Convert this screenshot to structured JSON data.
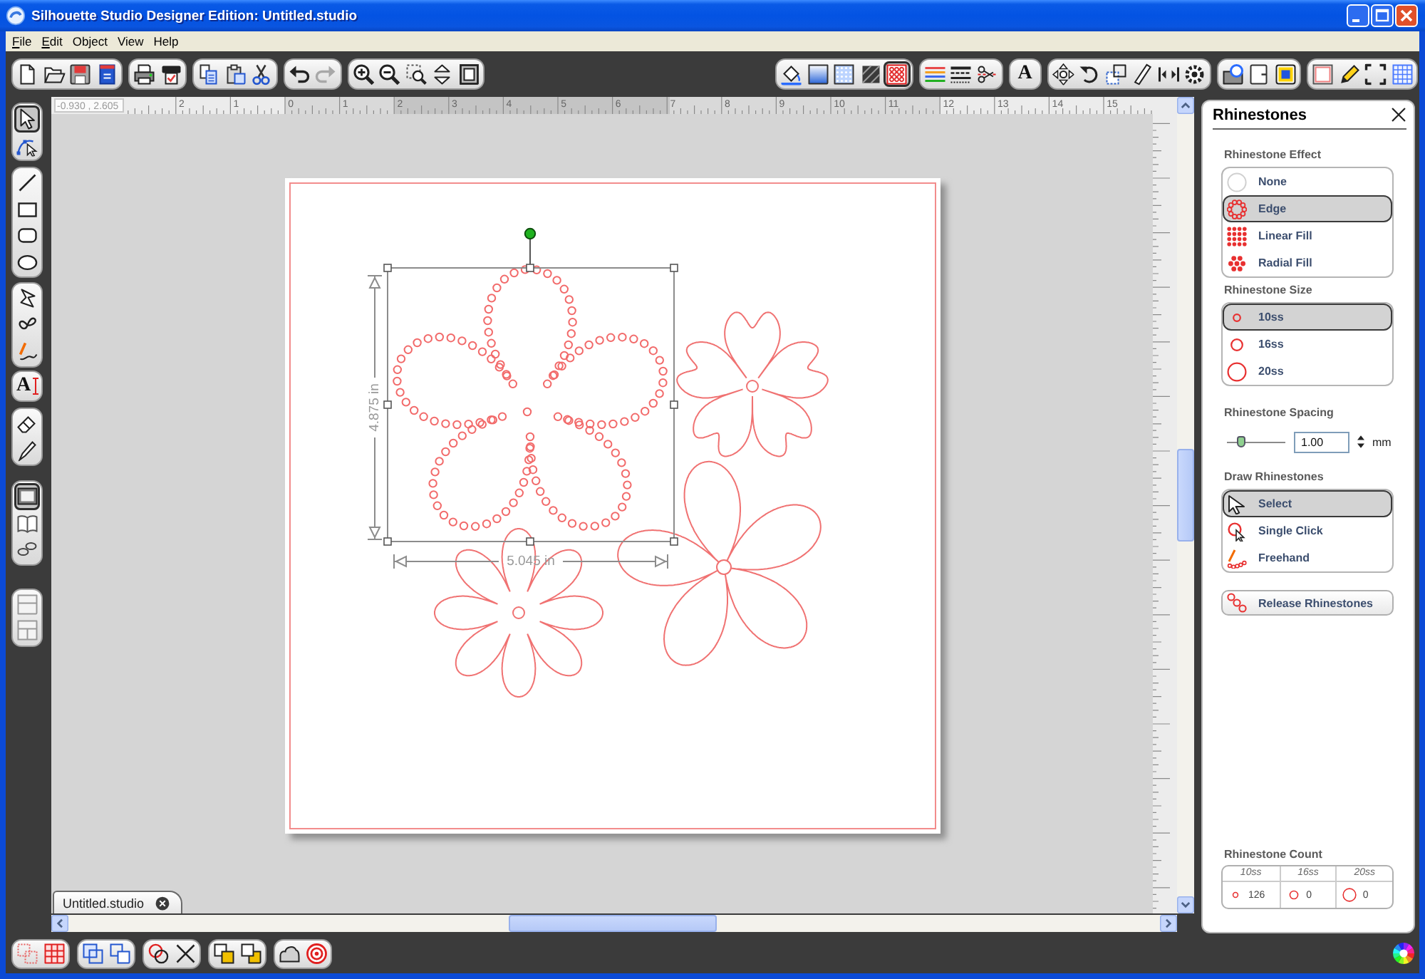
{
  "window": {
    "title": "Silhouette Studio Designer Edition: Untitled.studio"
  },
  "menu": [
    {
      "label": "File",
      "underline_first": true
    },
    {
      "label": "Edit",
      "underline_first": true
    },
    {
      "label": "Object",
      "underline_first": false
    },
    {
      "label": "View",
      "underline_first": false
    },
    {
      "label": "Help",
      "underline_first": false
    }
  ],
  "toolbar": {
    "left_groups": [
      {
        "items": [
          {
            "kind": "new"
          },
          {
            "kind": "open"
          },
          {
            "kind": "save"
          },
          {
            "kind": "save_library"
          }
        ]
      },
      {
        "items": [
          {
            "kind": "print"
          },
          {
            "kind": "send"
          }
        ]
      },
      {
        "items": [
          {
            "kind": "copy"
          },
          {
            "kind": "paste"
          },
          {
            "kind": "cut"
          }
        ]
      },
      {
        "items": [
          {
            "kind": "undo",
            "disabled": false
          },
          {
            "kind": "redo",
            "disabled": true
          }
        ]
      },
      {
        "items": [
          {
            "kind": "zoom_in"
          },
          {
            "kind": "zoom_out"
          },
          {
            "kind": "zoom_area"
          },
          {
            "kind": "zoom_drag"
          },
          {
            "kind": "zoom_fit"
          }
        ]
      }
    ],
    "right_groups": [
      {
        "items": [
          {
            "kind": "fill",
            "selected": false
          },
          {
            "kind": "gradient",
            "selected": false
          },
          {
            "kind": "pattern",
            "selected": false
          },
          {
            "kind": "texture",
            "selected": false
          },
          {
            "kind": "rhinestone",
            "selected": true
          }
        ]
      },
      {
        "items": [
          {
            "kind": "line_color",
            "selected": false
          },
          {
            "kind": "line_style",
            "selected": false
          },
          {
            "kind": "cut_style",
            "selected": false
          }
        ]
      },
      {
        "items": [
          {
            "kind": "text",
            "glyph": "A",
            "selected": false
          }
        ]
      },
      {
        "items": [
          {
            "kind": "move",
            "selected": false
          },
          {
            "kind": "rotate",
            "selected": false
          },
          {
            "kind": "scale",
            "selected": false
          },
          {
            "kind": "shear",
            "selected": false
          },
          {
            "kind": "align",
            "selected": false
          },
          {
            "kind": "replicate",
            "selected": false
          }
        ]
      },
      {
        "items": [
          {
            "kind": "library",
            "selected": false
          },
          {
            "kind": "page_arrow",
            "selected": false
          },
          {
            "kind": "registration",
            "selected": false
          }
        ]
      },
      {
        "items": [
          {
            "kind": "page_settings",
            "selected": false
          },
          {
            "kind": "pencil",
            "selected": false
          },
          {
            "kind": "fullscreen",
            "selected": false
          },
          {
            "kind": "grid",
            "selected": false
          }
        ]
      }
    ]
  },
  "tools": {
    "groups": [
      {
        "items": [
          {
            "kind": "pointer",
            "selected": true
          },
          {
            "kind": "node",
            "selected": false
          }
        ]
      },
      {
        "items": [
          {
            "kind": "line",
            "selected": false
          },
          {
            "kind": "rect",
            "selected": false
          },
          {
            "kind": "rounded",
            "selected": false
          },
          {
            "kind": "ellipse",
            "selected": false
          }
        ]
      },
      {
        "items": [
          {
            "kind": "polygon",
            "selected": false
          },
          {
            "kind": "curve",
            "selected": false
          },
          {
            "kind": "freehand",
            "selected": false
          }
        ]
      },
      {
        "items": [
          {
            "kind": "text",
            "glyph": "A",
            "selected": false
          }
        ]
      },
      {
        "items": [
          {
            "kind": "eraser",
            "selected": false
          },
          {
            "kind": "knife",
            "selected": false
          }
        ]
      },
      {
        "items": [
          {
            "kind": "page_view",
            "selected": true
          },
          {
            "kind": "book",
            "selected": false
          },
          {
            "kind": "chain",
            "selected": false
          }
        ]
      },
      {
        "items": [
          {
            "kind": "split_h",
            "selected": false
          },
          {
            "kind": "split_q",
            "selected": false
          }
        ]
      }
    ]
  },
  "canvas": {
    "ruler": {
      "readout": "-0.930 , 2.605",
      "labels": [
        "2",
        "1",
        "0",
        "1",
        "2",
        "3",
        "4",
        "5",
        "6",
        "7",
        "8",
        "9",
        "10",
        "11",
        "12",
        "13",
        "14",
        "15"
      ]
    },
    "selection": {
      "height_label": "4.875 in",
      "width_label": "5.045 in"
    },
    "document_tab": {
      "label": "Untitled.studio"
    }
  },
  "panel": {
    "title": "Rhinestones",
    "sections": [
      {
        "kind": "options",
        "heading": "Rhinestone Effect",
        "options": [
          {
            "label": "None",
            "kind": "none",
            "selected": false
          },
          {
            "label": "Edge",
            "kind": "edge",
            "selected": true
          },
          {
            "label": "Linear Fill",
            "kind": "linear",
            "selected": false
          },
          {
            "label": "Radial Fill",
            "kind": "radial",
            "selected": false
          }
        ]
      },
      {
        "kind": "options",
        "heading": "Rhinestone Size",
        "options": [
          {
            "label": "10ss",
            "kind": "small",
            "selected": true
          },
          {
            "label": "16ss",
            "kind": "medium",
            "selected": false
          },
          {
            "label": "20ss",
            "kind": "large",
            "selected": false
          }
        ]
      },
      {
        "kind": "slider",
        "heading": "Rhinestone Spacing",
        "level": 0.2,
        "value": "1.00",
        "unit": "mm"
      },
      {
        "kind": "options",
        "heading": "Draw Rhinestones",
        "options": [
          {
            "label": "Select",
            "kind": "select",
            "selected": true
          },
          {
            "label": "Single Click",
            "kind": "click",
            "selected": false
          },
          {
            "label": "Freehand",
            "kind": "freehand",
            "selected": false
          }
        ]
      },
      {
        "kind": "button",
        "label": "Release Rhinestones"
      },
      {
        "kind": "count",
        "heading": "Rhinestone Count",
        "columns": [
          {
            "label": "10ss",
            "kind": "small",
            "value": "126"
          },
          {
            "label": "16ss",
            "kind": "medium",
            "value": "0"
          },
          {
            "label": "20ss",
            "kind": "large",
            "value": "0"
          }
        ]
      }
    ]
  },
  "bottom_toolbar": {
    "groups": [
      {
        "items": [
          {
            "kind": "group"
          },
          {
            "kind": "ungroup"
          }
        ]
      },
      {
        "items": [
          {
            "kind": "merge"
          },
          {
            "kind": "offset"
          }
        ]
      },
      {
        "items": [
          {
            "kind": "circles"
          },
          {
            "kind": "cross"
          }
        ]
      },
      {
        "items": [
          {
            "kind": "front"
          },
          {
            "kind": "back"
          }
        ]
      },
      {
        "items": [
          {
            "kind": "blob"
          },
          {
            "kind": "target"
          }
        ]
      }
    ]
  }
}
